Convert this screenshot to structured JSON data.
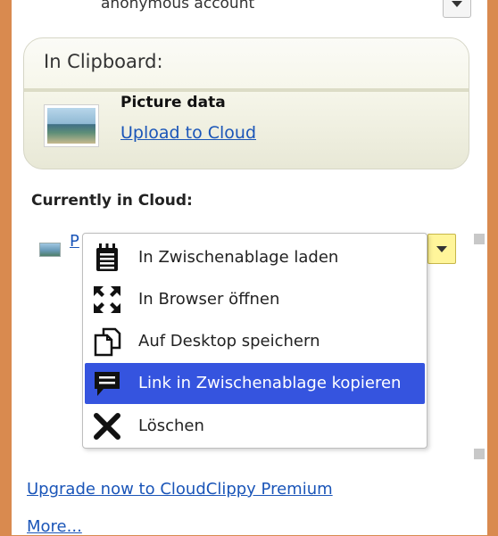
{
  "account": {
    "label": "anonymous account"
  },
  "clipboard": {
    "title": "In Clipboard:",
    "item_label": "Picture data",
    "upload_link": "Upload to Cloud"
  },
  "cloud": {
    "title": "Currently in Cloud:",
    "item_label": "P"
  },
  "context_menu": {
    "items": [
      {
        "label": "In Zwischenablage laden",
        "icon": "clipboard-icon"
      },
      {
        "label": "In Browser öffnen",
        "icon": "expand-arrows-icon"
      },
      {
        "label": "Auf Desktop speichern",
        "icon": "document-copy-icon"
      },
      {
        "label": "Link in Zwischenablage kopieren",
        "icon": "speech-bubble-icon",
        "highlighted": true
      },
      {
        "label": "Löschen",
        "icon": "close-x-icon"
      }
    ]
  },
  "footer": {
    "upgrade_link": "Upgrade now to CloudClippy Premium",
    "more_link": "More..."
  },
  "colors": {
    "window_border": "#d98a4f",
    "link": "#1a55b8",
    "menu_highlight": "#3554df",
    "dropdown_yellow": "#fff59a"
  }
}
